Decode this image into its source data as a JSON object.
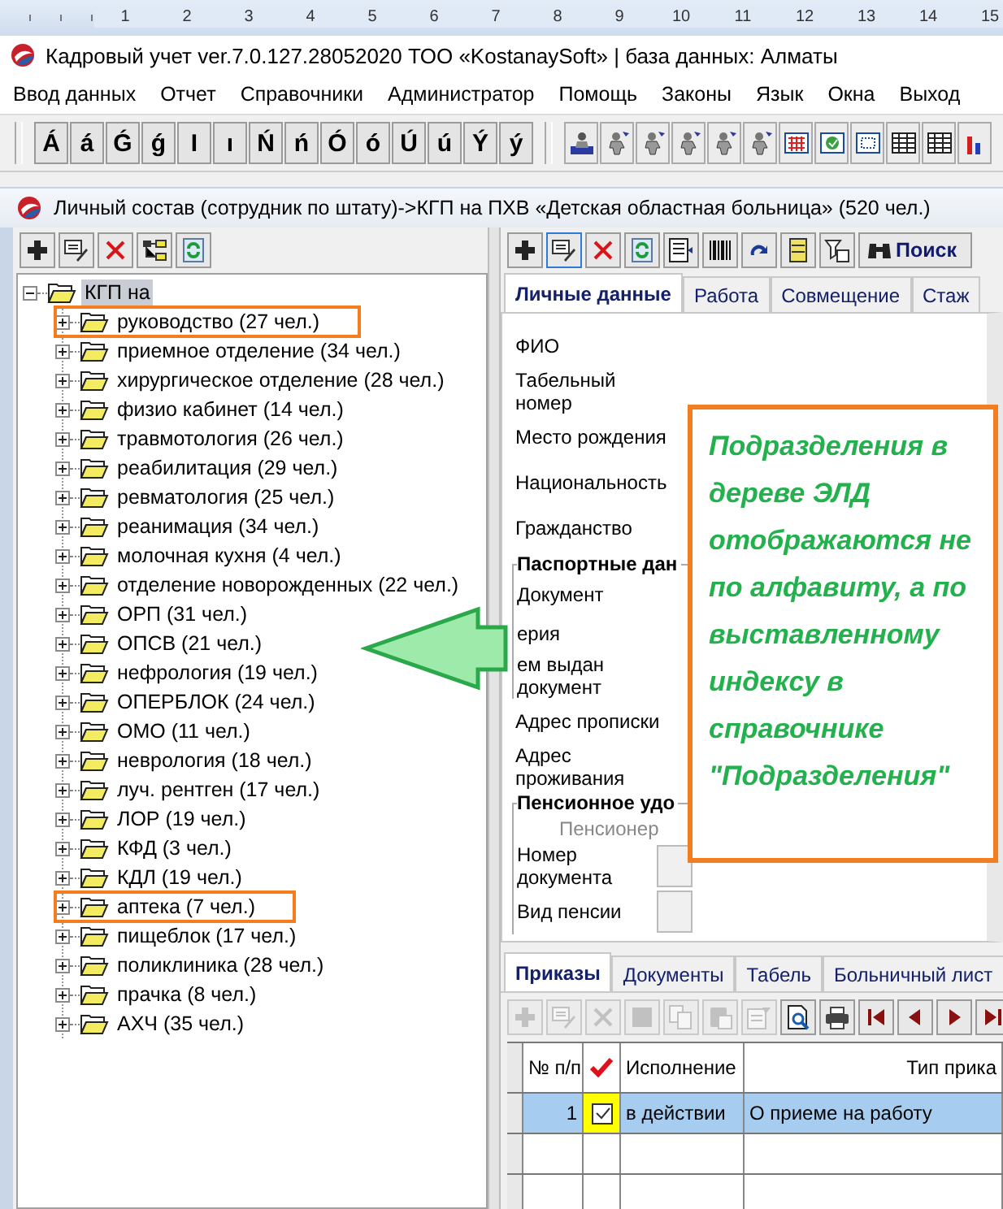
{
  "ruler": {
    "numbers": [
      "1",
      "2",
      "3",
      "4",
      "5",
      "6",
      "7",
      "8",
      "9",
      "10",
      "11",
      "12",
      "13",
      "14",
      "15"
    ]
  },
  "app": {
    "title": "Кадровый учет ver.7.0.127.28052020 ТОО «KostanaySoft» | база данных: Алматы"
  },
  "menu": [
    "Ввод данных",
    "Отчет",
    "Справочники",
    "Администратор",
    "Помощь",
    "Законы",
    "Язык",
    "Окна",
    "Выход"
  ],
  "letter_keys": [
    "Á",
    "á",
    "Ǵ",
    "ǵ",
    "І",
    "ı",
    "Ń",
    "ń",
    "Ó",
    "ó",
    "Ú",
    "ú",
    "Ý",
    "ý"
  ],
  "tool_icons": [
    {
      "kind": "figure-board"
    },
    {
      "kind": "figure"
    },
    {
      "kind": "figure"
    },
    {
      "kind": "figure"
    },
    {
      "kind": "figure"
    },
    {
      "kind": "figure"
    },
    {
      "kind": "calendar"
    },
    {
      "kind": "calendar-check"
    },
    {
      "kind": "calendar-blank"
    },
    {
      "kind": "table"
    },
    {
      "kind": "table"
    },
    {
      "kind": "chart"
    }
  ],
  "child_window": {
    "title": "Личный состав (сотрудник по штату)->КГП на ПХВ «Детская областная больница» (520 чел.)"
  },
  "tree_toolbar": [
    {
      "kind": "add"
    },
    {
      "kind": "edit"
    },
    {
      "kind": "delete"
    },
    {
      "kind": "tree"
    },
    {
      "kind": "refresh"
    }
  ],
  "tree": {
    "label": "КГП на",
    "expanded": true,
    "selected": true,
    "children": [
      {
        "label": "руководство (27 чел.)",
        "expanded": false,
        "highlighted": true
      },
      {
        "label": "приемное отделение (34 чел.)",
        "expanded": false,
        "highlighted": false
      },
      {
        "label": "хирургическое отделение (28 чел.)",
        "expanded": false,
        "highlighted": false
      },
      {
        "label": "физио кабинет (14 чел.)",
        "expanded": false,
        "highlighted": false
      },
      {
        "label": "травмотология (26 чел.)",
        "expanded": false,
        "highlighted": false
      },
      {
        "label": "реабилитация (29 чел.)",
        "expanded": false,
        "highlighted": false
      },
      {
        "label": "ревматология (25 чел.)",
        "expanded": false,
        "highlighted": false
      },
      {
        "label": "реанимация (34 чел.)",
        "expanded": false,
        "highlighted": false
      },
      {
        "label": "молочная кухня (4 чел.)",
        "expanded": false,
        "highlighted": false
      },
      {
        "label": "отделение новорожденных (22 чел.)",
        "expanded": false,
        "highlighted": false
      },
      {
        "label": "ОРП (31 чел.)",
        "expanded": false,
        "highlighted": false
      },
      {
        "label": "ОПСВ (21 чел.)",
        "expanded": false,
        "highlighted": false
      },
      {
        "label": "нефрология (19 чел.)",
        "expanded": false,
        "highlighted": false
      },
      {
        "label": "ОПЕРБЛОК (24 чел.)",
        "expanded": false,
        "highlighted": false
      },
      {
        "label": "ОМО (11 чел.)",
        "expanded": false,
        "highlighted": false
      },
      {
        "label": "неврология (18 чел.)",
        "expanded": false,
        "highlighted": false
      },
      {
        "label": "луч. рентген (17 чел.)",
        "expanded": false,
        "highlighted": false
      },
      {
        "label": "ЛОР (19 чел.)",
        "expanded": false,
        "highlighted": false
      },
      {
        "label": "КФД (3 чел.)",
        "expanded": false,
        "highlighted": false
      },
      {
        "label": "КДЛ (19 чел.)",
        "expanded": false,
        "highlighted": false
      },
      {
        "label": "аптека (7 чел.)",
        "expanded": false,
        "highlighted": true
      },
      {
        "label": "пищеблок (17 чел.)",
        "expanded": false,
        "highlighted": false
      },
      {
        "label": "поликлиника (28 чел.)",
        "expanded": false,
        "highlighted": false
      },
      {
        "label": "прачка (8 чел.)",
        "expanded": false,
        "highlighted": false
      },
      {
        "label": "АХЧ (35 чел.)",
        "expanded": false,
        "highlighted": false
      }
    ]
  },
  "record_toolbar": {
    "buttons": [
      {
        "kind": "add"
      },
      {
        "kind": "edit"
      },
      {
        "kind": "delete"
      },
      {
        "kind": "refresh"
      },
      {
        "kind": "list"
      },
      {
        "kind": "barcode"
      },
      {
        "kind": "redo"
      },
      {
        "kind": "cabinet"
      },
      {
        "kind": "filter"
      }
    ],
    "search": {
      "label": "Поиск"
    }
  },
  "record_tabs": [
    {
      "label": "Личные данные",
      "selected": true
    },
    {
      "label": "Работа",
      "selected": false
    },
    {
      "label": "Совмещение",
      "selected": false
    },
    {
      "label": "Стаж",
      "selected": false
    }
  ],
  "form": {
    "fields": [
      "ФИО",
      "Табельный номер",
      "Место рождения",
      "Национальность",
      "Гражданство"
    ],
    "passport": {
      "title": "Паспортные дан",
      "fields": [
        "Документ",
        "ерия",
        "ем выдан документ"
      ]
    },
    "addresses": [
      "Адрес прописки",
      "Адрес проживания"
    ],
    "pension": {
      "title": "Пенсионное удо",
      "status": "Пенсионер",
      "fields": [
        "Номер документа",
        "Вид пенсии"
      ]
    }
  },
  "orders_tabs": [
    {
      "label": "Приказы",
      "selected": true
    },
    {
      "label": "Документы",
      "selected": false
    },
    {
      "label": "Табель",
      "selected": false
    },
    {
      "label": "Больничный лист",
      "selected": false
    }
  ],
  "orders_toolbar": [
    {
      "kind": "add",
      "disabled": true
    },
    {
      "kind": "edit",
      "disabled": true
    },
    {
      "kind": "delete",
      "disabled": true
    },
    {
      "kind": "square",
      "disabled": true
    },
    {
      "kind": "copy",
      "disabled": true
    },
    {
      "kind": "paste",
      "disabled": true
    },
    {
      "kind": "props",
      "disabled": true
    },
    {
      "kind": "preview",
      "disabled": false
    },
    {
      "kind": "print",
      "disabled": false
    },
    {
      "kind": "first",
      "disabled": false
    },
    {
      "kind": "prev",
      "disabled": false
    },
    {
      "kind": "next",
      "disabled": false
    },
    {
      "kind": "last",
      "disabled": false
    }
  ],
  "orders_table": {
    "columns": [
      {
        "kind": "text",
        "label": "№ п/п"
      },
      {
        "kind": "check"
      },
      {
        "kind": "text",
        "label": "Исполнение"
      },
      {
        "kind": "text",
        "label": "Тип прика"
      }
    ],
    "rows": [
      {
        "number": "1",
        "checked": true,
        "status": "в действии",
        "type": "О приеме на работу",
        "selected": true
      }
    ]
  },
  "annotation": {
    "text": "Подразделения в дереве ЭЛД отображаются не по алфавиту, а по выставленному индексу в справочнике \"Подразделения\""
  }
}
